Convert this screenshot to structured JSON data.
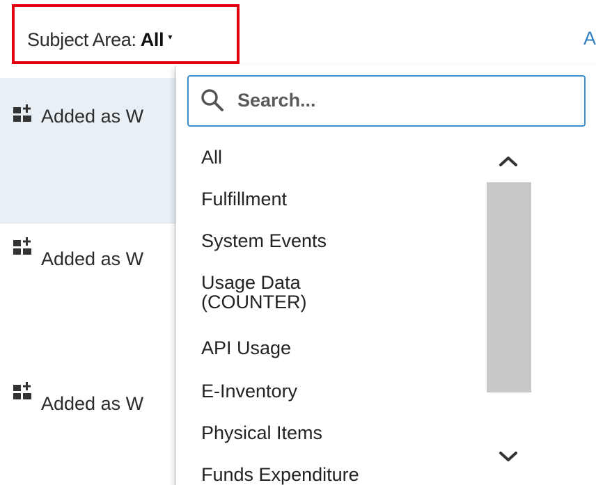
{
  "subject_area": {
    "label": "Subject Area:",
    "value": "All",
    "caret": "▾"
  },
  "right_link": "A",
  "list_rows": [
    {
      "text": "Added as W",
      "icon": "add-widget-icon",
      "selected": true
    },
    {
      "text": "Added as W",
      "icon": "add-widget-icon",
      "selected": false
    },
    {
      "text": "Added as W",
      "icon": "add-widget-icon",
      "selected": false
    }
  ],
  "dropdown": {
    "search_placeholder": "Search...",
    "options": [
      "All",
      "Fulfillment",
      "System Events",
      "Usage Data (COUNTER)",
      "API Usage",
      "E-Inventory",
      "Physical Items",
      "Funds Expenditure"
    ]
  },
  "colors": {
    "highlight_border": "#e0000f",
    "search_border": "#3b8ed0",
    "link": "#2d7dc0",
    "selected_row": "#e8f0f6",
    "scroll_thumb": "#c8c8c8"
  },
  "icons": [
    "add-widget-icon",
    "search-icon",
    "chevron-up-icon",
    "chevron-down-icon"
  ]
}
